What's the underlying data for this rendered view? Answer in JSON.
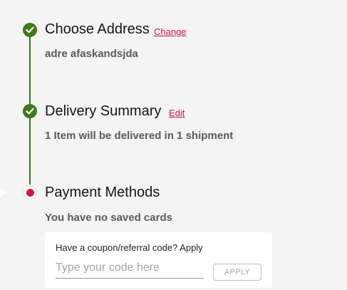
{
  "steps": [
    {
      "title": "Choose Address",
      "action": "Change",
      "detail": "adre afaskandsjda",
      "status": "complete"
    },
    {
      "title": "Delivery Summary",
      "action": "Edit",
      "detail": "1 Item will be delivered in 1 shipment",
      "status": "complete"
    },
    {
      "title": "Payment Methods",
      "detail": "You have no saved cards",
      "status": "active"
    }
  ],
  "coupon": {
    "label": "Have a coupon/referral code? Apply",
    "placeholder": "Type your code here",
    "button_label": "APPLY"
  },
  "icons": {
    "complete": "check-circle-icon",
    "active": "active-step-dot-icon"
  },
  "colors": {
    "complete": "#3d7a18",
    "accent": "#c8174b",
    "active_dot": "#d9124a",
    "background": "#f4f4f4"
  }
}
